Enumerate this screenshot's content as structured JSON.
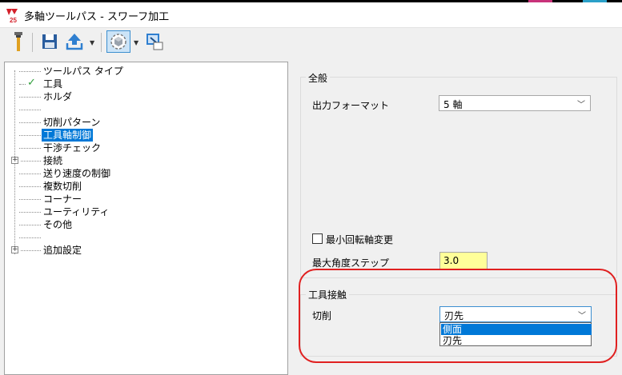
{
  "window": {
    "title": "多軸ツールパス - スワーフ加工",
    "app_logo_text": "25"
  },
  "toolbar": {
    "buttons": [
      {
        "icon": "tool-icon"
      },
      {
        "icon": "save-icon"
      },
      {
        "icon": "export-icon"
      },
      {
        "icon": "view-icon"
      },
      {
        "icon": "preview-icon"
      }
    ]
  },
  "tree": {
    "items": [
      {
        "label": "ツールパス タイプ"
      },
      {
        "label": "工具",
        "checked": true
      },
      {
        "label": "ホルダ"
      },
      {
        "label": ""
      },
      {
        "label": "切削パターン"
      },
      {
        "label": "工具軸制御",
        "selected": true
      },
      {
        "label": "干渉チェック"
      },
      {
        "label": "接続",
        "expandable": true
      },
      {
        "label": "送り速度の制御"
      },
      {
        "label": "複数切削"
      },
      {
        "label": "コーナー"
      },
      {
        "label": "ユーティリティ"
      },
      {
        "label": "その他"
      },
      {
        "label": ""
      },
      {
        "label": "追加設定",
        "expandable": true
      }
    ]
  },
  "general_group": {
    "title": "全般",
    "output_format_label": "出力フォーマット",
    "output_format_value": "5 軸",
    "min_rotary_label": "最小回転軸変更",
    "min_rotary_checked": false,
    "max_angle_label": "最大角度ステップ",
    "max_angle_value": "3.0"
  },
  "tool_contact_group": {
    "title": "工具接触",
    "cutting_label": "切削",
    "cutting_value": "刃先",
    "options": [
      "側面",
      "刃先"
    ],
    "highlighted_option": "側面"
  },
  "colors": {
    "selection": "#0078d7",
    "annotation": "#e02020",
    "input_highlight": "#ffff99",
    "check": "#2e9e3a"
  }
}
